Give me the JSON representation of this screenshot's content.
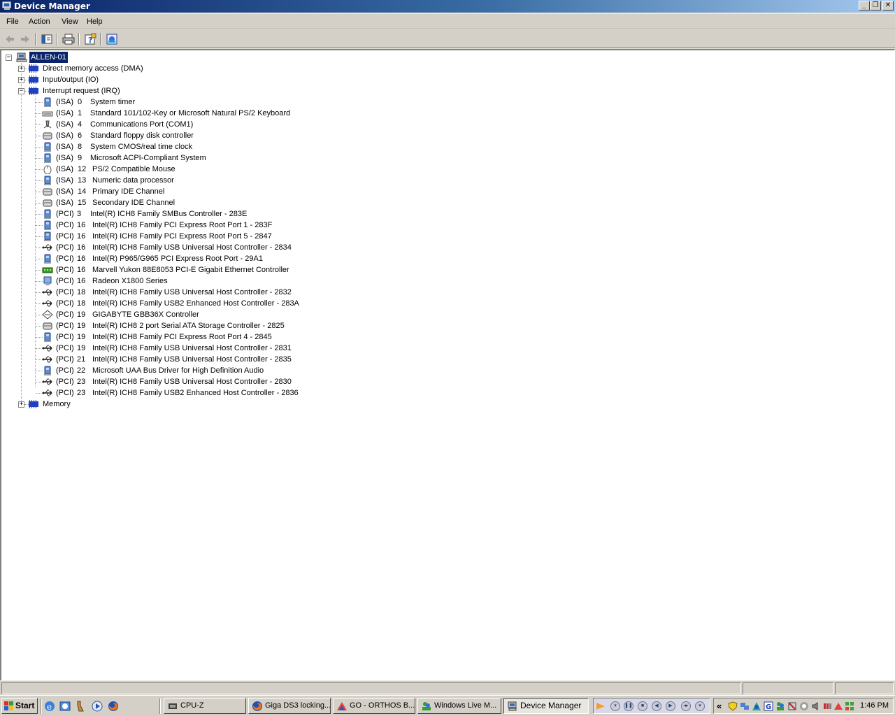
{
  "window": {
    "title": "Device Manager",
    "controls": {
      "minimize": "_",
      "restore": "❐",
      "close": "✕"
    }
  },
  "menu": [
    "File",
    "Action",
    "View",
    "Help"
  ],
  "toolbar": [
    "back-icon",
    "forward-icon",
    "show-hide-console-tree-icon",
    "print-icon",
    "help-icon",
    "properties-icon"
  ],
  "tree": {
    "root": "ALLEN-01",
    "categories": [
      {
        "label": "Direct memory access (DMA)",
        "expanded": false
      },
      {
        "label": "Input/output (IO)",
        "expanded": false
      },
      {
        "label": "Interrupt request (IRQ)",
        "expanded": true
      },
      {
        "label": "Memory",
        "expanded": false
      }
    ],
    "irq_items": [
      {
        "bus": "(ISA)",
        "irq": "0",
        "name": "System timer",
        "icon": "system"
      },
      {
        "bus": "(ISA)",
        "irq": "1",
        "name": "Standard 101/102-Key or Microsoft Natural PS/2 Keyboard",
        "icon": "keyboard"
      },
      {
        "bus": "(ISA)",
        "irq": "4",
        "name": "Communications Port (COM1)",
        "icon": "port"
      },
      {
        "bus": "(ISA)",
        "irq": "6",
        "name": "Standard floppy disk controller",
        "icon": "disk"
      },
      {
        "bus": "(ISA)",
        "irq": "8",
        "name": "System CMOS/real time clock",
        "icon": "system"
      },
      {
        "bus": "(ISA)",
        "irq": "9",
        "name": "Microsoft ACPI-Compliant System",
        "icon": "system"
      },
      {
        "bus": "(ISA)",
        "irq": "12",
        "name": "PS/2 Compatible Mouse",
        "icon": "mouse"
      },
      {
        "bus": "(ISA)",
        "irq": "13",
        "name": "Numeric data processor",
        "icon": "system"
      },
      {
        "bus": "(ISA)",
        "irq": "14",
        "name": "Primary IDE Channel",
        "icon": "disk"
      },
      {
        "bus": "(ISA)",
        "irq": "15",
        "name": "Secondary IDE Channel",
        "icon": "disk"
      },
      {
        "bus": "(PCI)",
        "irq": "3",
        "name": "Intel(R) ICH8 Family SMBus Controller - 283E",
        "icon": "system"
      },
      {
        "bus": "(PCI)",
        "irq": "16",
        "name": "Intel(R) ICH8 Family PCI Express Root Port 1 - 283F",
        "icon": "system"
      },
      {
        "bus": "(PCI)",
        "irq": "16",
        "name": "Intel(R) ICH8 Family PCI Express Root Port 5 - 2847",
        "icon": "system"
      },
      {
        "bus": "(PCI)",
        "irq": "16",
        "name": "Intel(R) ICH8 Family USB Universal Host Controller - 2834",
        "icon": "usb"
      },
      {
        "bus": "(PCI)",
        "irq": "16",
        "name": "Intel(R) P965/G965 PCI Express Root Port - 29A1",
        "icon": "system"
      },
      {
        "bus": "(PCI)",
        "irq": "16",
        "name": "Marvell Yukon 88E8053 PCI-E Gigabit Ethernet Controller",
        "icon": "network"
      },
      {
        "bus": "(PCI)",
        "irq": "16",
        "name": "Radeon X1800 Series",
        "icon": "display"
      },
      {
        "bus": "(PCI)",
        "irq": "18",
        "name": "Intel(R) ICH8 Family USB Universal Host Controller - 2832",
        "icon": "usb"
      },
      {
        "bus": "(PCI)",
        "irq": "18",
        "name": "Intel(R) ICH8 Family USB2 Enhanced Host Controller - 283A",
        "icon": "usb"
      },
      {
        "bus": "(PCI)",
        "irq": "19",
        "name": "GIGABYTE GBB36X Controller",
        "icon": "scsi"
      },
      {
        "bus": "(PCI)",
        "irq": "19",
        "name": "Intel(R) ICH8 2 port Serial ATA Storage Controller - 2825",
        "icon": "disk"
      },
      {
        "bus": "(PCI)",
        "irq": "19",
        "name": "Intel(R) ICH8 Family PCI Express Root Port 4 - 2845",
        "icon": "system"
      },
      {
        "bus": "(PCI)",
        "irq": "19",
        "name": "Intel(R) ICH8 Family USB Universal Host Controller - 2831",
        "icon": "usb"
      },
      {
        "bus": "(PCI)",
        "irq": "21",
        "name": "Intel(R) ICH8 Family USB Universal Host Controller - 2835",
        "icon": "usb"
      },
      {
        "bus": "(PCI)",
        "irq": "22",
        "name": "Microsoft UAA Bus Driver for High Definition Audio",
        "icon": "system"
      },
      {
        "bus": "(PCI)",
        "irq": "23",
        "name": "Intel(R) ICH8 Family USB Universal Host Controller - 2830",
        "icon": "usb"
      },
      {
        "bus": "(PCI)",
        "irq": "23",
        "name": "Intel(R) ICH8 Family USB2 Enhanced Host Controller - 2836",
        "icon": "usb"
      }
    ]
  },
  "taskbar": {
    "start": "Start",
    "quicklaunch": [
      "ie-icon",
      "outlook-icon",
      "tool-icon",
      "media-player-icon",
      "firefox-icon"
    ],
    "tasks": [
      {
        "label": "CPU-Z",
        "active": false,
        "icon": "cpuz-icon"
      },
      {
        "label": "Giga DS3 locking...",
        "active": false,
        "icon": "firefox-icon"
      },
      {
        "label": "GO - ORTHOS B...",
        "active": false,
        "icon": "orthos-icon"
      },
      {
        "label": "Windows Live M...",
        "active": false,
        "icon": "messenger-icon"
      },
      {
        "label": "Device Manager",
        "active": true,
        "icon": "device-manager-icon"
      }
    ],
    "tray_chevron": "«",
    "clock": "1:46 PM"
  }
}
